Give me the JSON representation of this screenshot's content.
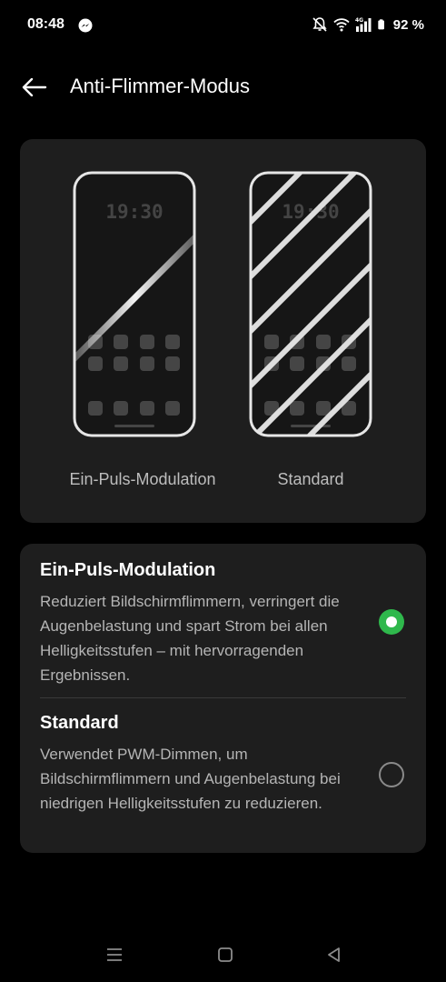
{
  "status_bar": {
    "time": "08:48",
    "battery": "92 %",
    "icons": [
      "messenger-icon",
      "mute-icon",
      "wifi-icon",
      "signal-4g-icon",
      "battery-icon"
    ],
    "network": "4G"
  },
  "header": {
    "title": "Anti-Flimmer-Modus",
    "back_icon": "arrow-left-icon"
  },
  "preview": {
    "left_label": "Ein-Puls-Modulation",
    "right_label": "Standard",
    "phone_time": "19:30"
  },
  "options": [
    {
      "title": "Ein-Puls-Modulation",
      "description": "Reduziert Bildschirmflimmern, verringert die Augenbelastung und spart Strom bei allen Helligkeitsstufen – mit hervorragenden Ergebnissen.",
      "selected": true
    },
    {
      "title": "Standard",
      "description": "Verwendet PWM-Dimmen, um Bildschirmflimmern und Augenbelastung bei niedrigen Helligkeitsstufen zu reduzieren.",
      "selected": false
    }
  ],
  "colors": {
    "accent": "#2fb84c",
    "card": "#1e1e1e",
    "background": "#000000"
  },
  "nav_bar": {
    "icons": [
      "menu-icon",
      "home-square-icon",
      "back-triangle-icon"
    ]
  }
}
